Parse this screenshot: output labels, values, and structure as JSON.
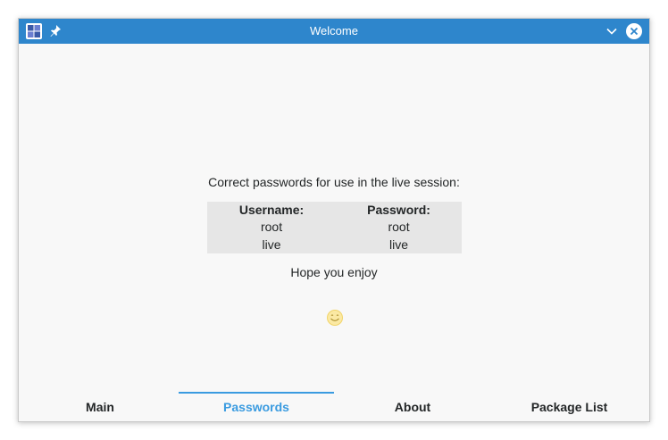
{
  "window": {
    "title": "Welcome"
  },
  "content": {
    "intro": "Correct passwords for use in the live session:",
    "table": {
      "headers": [
        "Username:",
        "Password:"
      ],
      "rows": [
        [
          "root",
          "root"
        ],
        [
          "live",
          "live"
        ]
      ]
    },
    "closing": "Hope you enjoy"
  },
  "tabs": [
    {
      "label": "Main"
    },
    {
      "label": "Passwords"
    },
    {
      "label": "About"
    },
    {
      "label": "Package List"
    }
  ],
  "active_tab": "Passwords",
  "colors": {
    "titlebar": "#2e86cc",
    "accent": "#3a9be0",
    "table_bg": "#e6e6e6",
    "text": "#232627"
  }
}
